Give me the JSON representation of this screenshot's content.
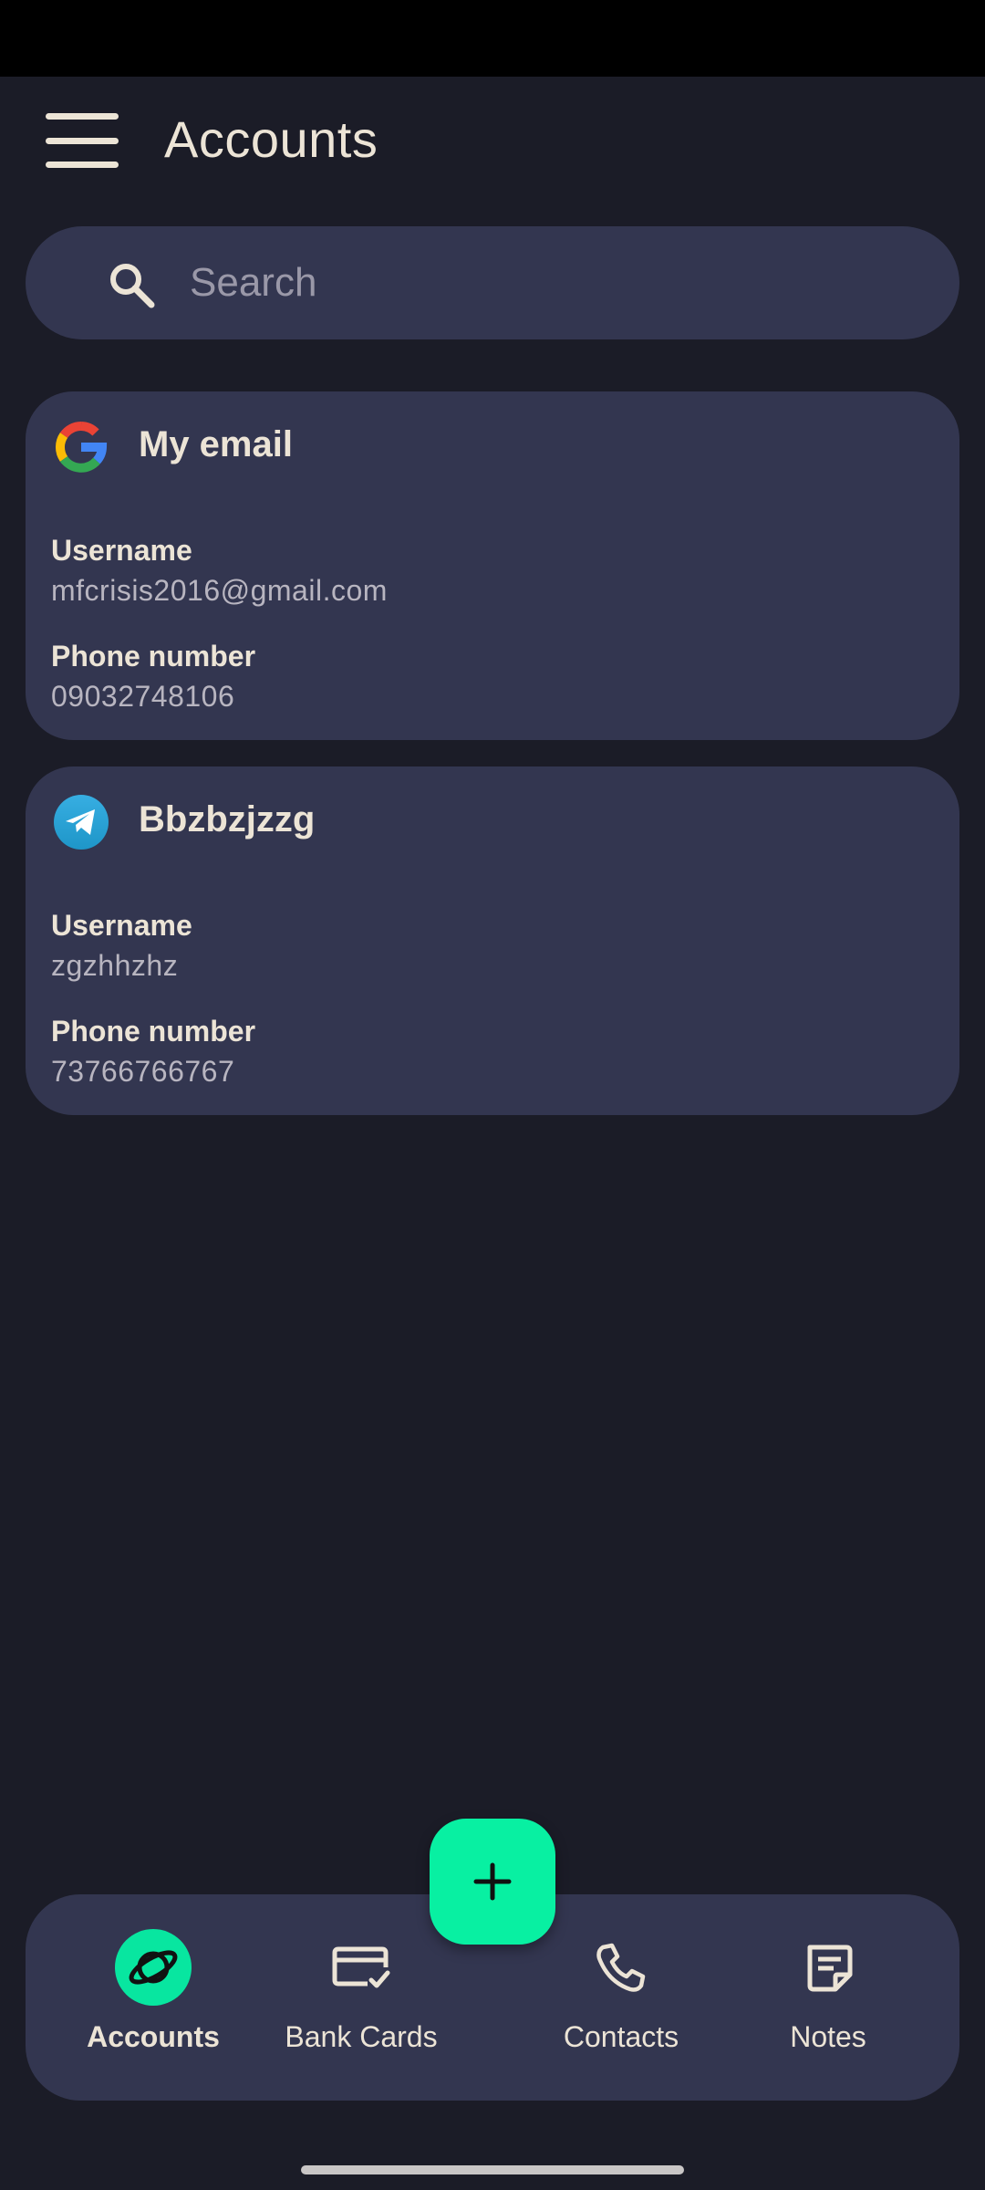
{
  "app_bar": {
    "title": "Accounts"
  },
  "search": {
    "placeholder": "Search"
  },
  "accounts": [
    {
      "name": "My email",
      "logo": "google-logo",
      "username_label": "Username",
      "username": "mfcrisis2016@gmail.com",
      "phone_label": "Phone number",
      "phone": "09032748106"
    },
    {
      "name": "Bbzbzjzzg",
      "logo": "telegram-logo",
      "username_label": "Username",
      "username": "zgzhhzhz",
      "phone_label": "Phone number",
      "phone": "73766766767"
    }
  ],
  "bottom_nav": {
    "items": [
      {
        "label": "Accounts",
        "icon": "planet-icon",
        "active": true
      },
      {
        "label": "Bank Cards",
        "icon": "credit-card-check-icon",
        "active": false
      },
      {
        "label": "Contacts",
        "icon": "phone-icon",
        "active": false
      },
      {
        "label": "Notes",
        "icon": "note-icon",
        "active": false
      }
    ]
  },
  "fab": {
    "icon": "plus-icon"
  },
  "colors": {
    "background": "#1b1c27",
    "surface": "#333650",
    "accent": "#08f0a2",
    "text": "#ece4d6",
    "muted_text": "#b8b5c0"
  }
}
